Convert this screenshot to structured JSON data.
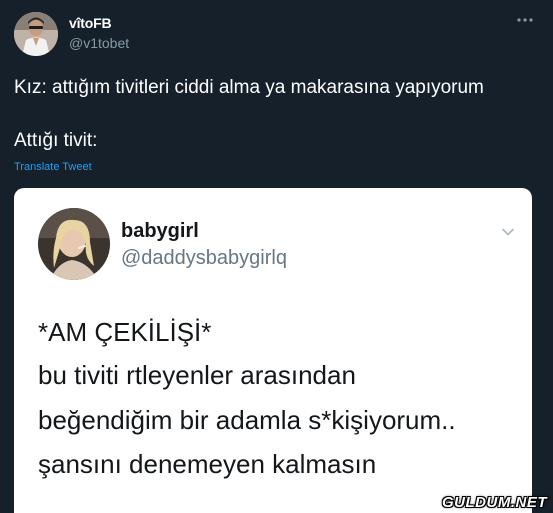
{
  "tweet": {
    "display_name": "vîtoFB",
    "handle": "@v1tobet",
    "more_icon": "more-horizontal-icon",
    "text_line1": "Kız: attığım tivitleri ciddi alma ya makarasına yapıyorum",
    "text_line2": "Attığı tivit:",
    "translate_label": "Translate Tweet",
    "link_color": "#1da1f2",
    "background_color": "#15202b"
  },
  "embedded": {
    "display_name": "babygirl",
    "handle": "@daddysbabygirlq",
    "chevron_icon": "chevron-down-icon",
    "lines": [
      "*AM ÇEKİLİŞİ*",
      "bu tiviti rtleyenler arasından",
      "beğendiğim bir adamla s*kişiyorum..",
      "şansını denemeyen kalmasın"
    ]
  },
  "watermark": {
    "text": "GULDUM.NET"
  }
}
